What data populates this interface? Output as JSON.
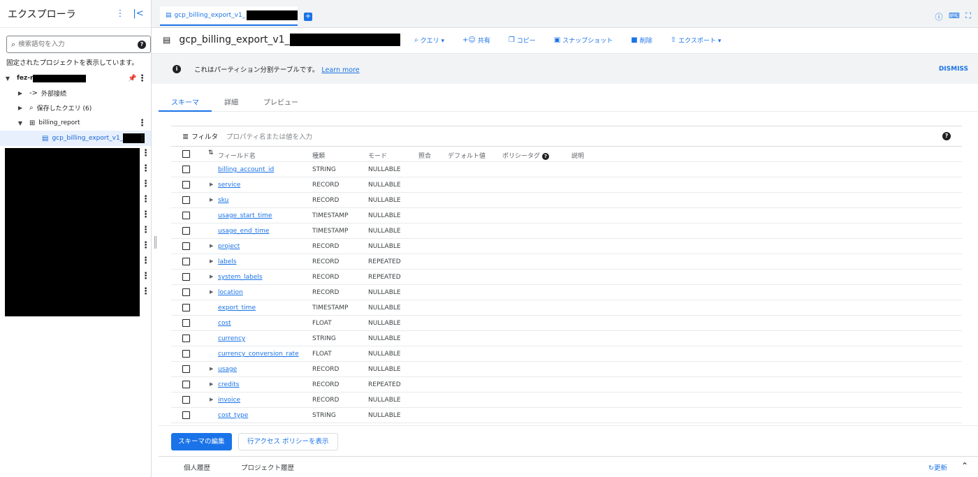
{
  "sidebar": {
    "title": "エクスプローラ",
    "search_placeholder": "検索語句を入力",
    "pinned_note": "固定されたプロジェクトを表示しています。",
    "project_label": "fez-r",
    "items": [
      {
        "label": "外部接続"
      },
      {
        "label": "保存したクエリ (6)"
      },
      {
        "label": "billing_report"
      },
      {
        "label": "gcp_billing_export_v1_"
      }
    ]
  },
  "tabs": {
    "active_label": "gcp_billing_export_v1_"
  },
  "toolbar": {
    "title": "gcp_billing_export_v1_",
    "actions": {
      "query": "クエリ ▾",
      "share": "共有",
      "copy": "コピー",
      "snapshot": "スナップショット",
      "delete": "削除",
      "export": "エクスポート ▾"
    }
  },
  "banner": {
    "message": "これはパーティション分割テーブルです。",
    "link": "Learn more",
    "dismiss": "DISMISS"
  },
  "subtabs": [
    "スキーマ",
    "詳細",
    "プレビュー"
  ],
  "filter": {
    "label": "フィルタ",
    "placeholder": "プロパティ名または値を入力"
  },
  "schema": {
    "headers": {
      "field": "フィールド名",
      "type": "種類",
      "mode": "モード",
      "collation": "照合",
      "default": "デフォルト値",
      "policy": "ポリシータグ",
      "description": "説明"
    },
    "rows": [
      {
        "name": "billing_account_id",
        "type": "STRING",
        "mode": "NULLABLE",
        "expandable": false
      },
      {
        "name": "service",
        "type": "RECORD",
        "mode": "NULLABLE",
        "expandable": true
      },
      {
        "name": "sku",
        "type": "RECORD",
        "mode": "NULLABLE",
        "expandable": true
      },
      {
        "name": "usage_start_time",
        "type": "TIMESTAMP",
        "mode": "NULLABLE",
        "expandable": false
      },
      {
        "name": "usage_end_time",
        "type": "TIMESTAMP",
        "mode": "NULLABLE",
        "expandable": false
      },
      {
        "name": "project",
        "type": "RECORD",
        "mode": "NULLABLE",
        "expandable": true
      },
      {
        "name": "labels",
        "type": "RECORD",
        "mode": "REPEATED",
        "expandable": true
      },
      {
        "name": "system_labels",
        "type": "RECORD",
        "mode": "REPEATED",
        "expandable": true
      },
      {
        "name": "location",
        "type": "RECORD",
        "mode": "NULLABLE",
        "expandable": true
      },
      {
        "name": "export_time",
        "type": "TIMESTAMP",
        "mode": "NULLABLE",
        "expandable": false
      },
      {
        "name": "cost",
        "type": "FLOAT",
        "mode": "NULLABLE",
        "expandable": false
      },
      {
        "name": "currency",
        "type": "STRING",
        "mode": "NULLABLE",
        "expandable": false
      },
      {
        "name": "currency_conversion_rate",
        "type": "FLOAT",
        "mode": "NULLABLE",
        "expandable": false
      },
      {
        "name": "usage",
        "type": "RECORD",
        "mode": "NULLABLE",
        "expandable": true
      },
      {
        "name": "credits",
        "type": "RECORD",
        "mode": "REPEATED",
        "expandable": true
      },
      {
        "name": "invoice",
        "type": "RECORD",
        "mode": "NULLABLE",
        "expandable": true
      },
      {
        "name": "cost_type",
        "type": "STRING",
        "mode": "NULLABLE",
        "expandable": false
      }
    ]
  },
  "bottom": {
    "edit_schema": "スキーマの編集",
    "row_access": "行アクセス ポリシーを表示"
  },
  "history": {
    "personal": "個人履歴",
    "project": "プロジェクト履歴",
    "refresh": "更新"
  },
  "colors": {
    "accent": "#1a73e8",
    "banner_bg": "#f1f3f4"
  }
}
